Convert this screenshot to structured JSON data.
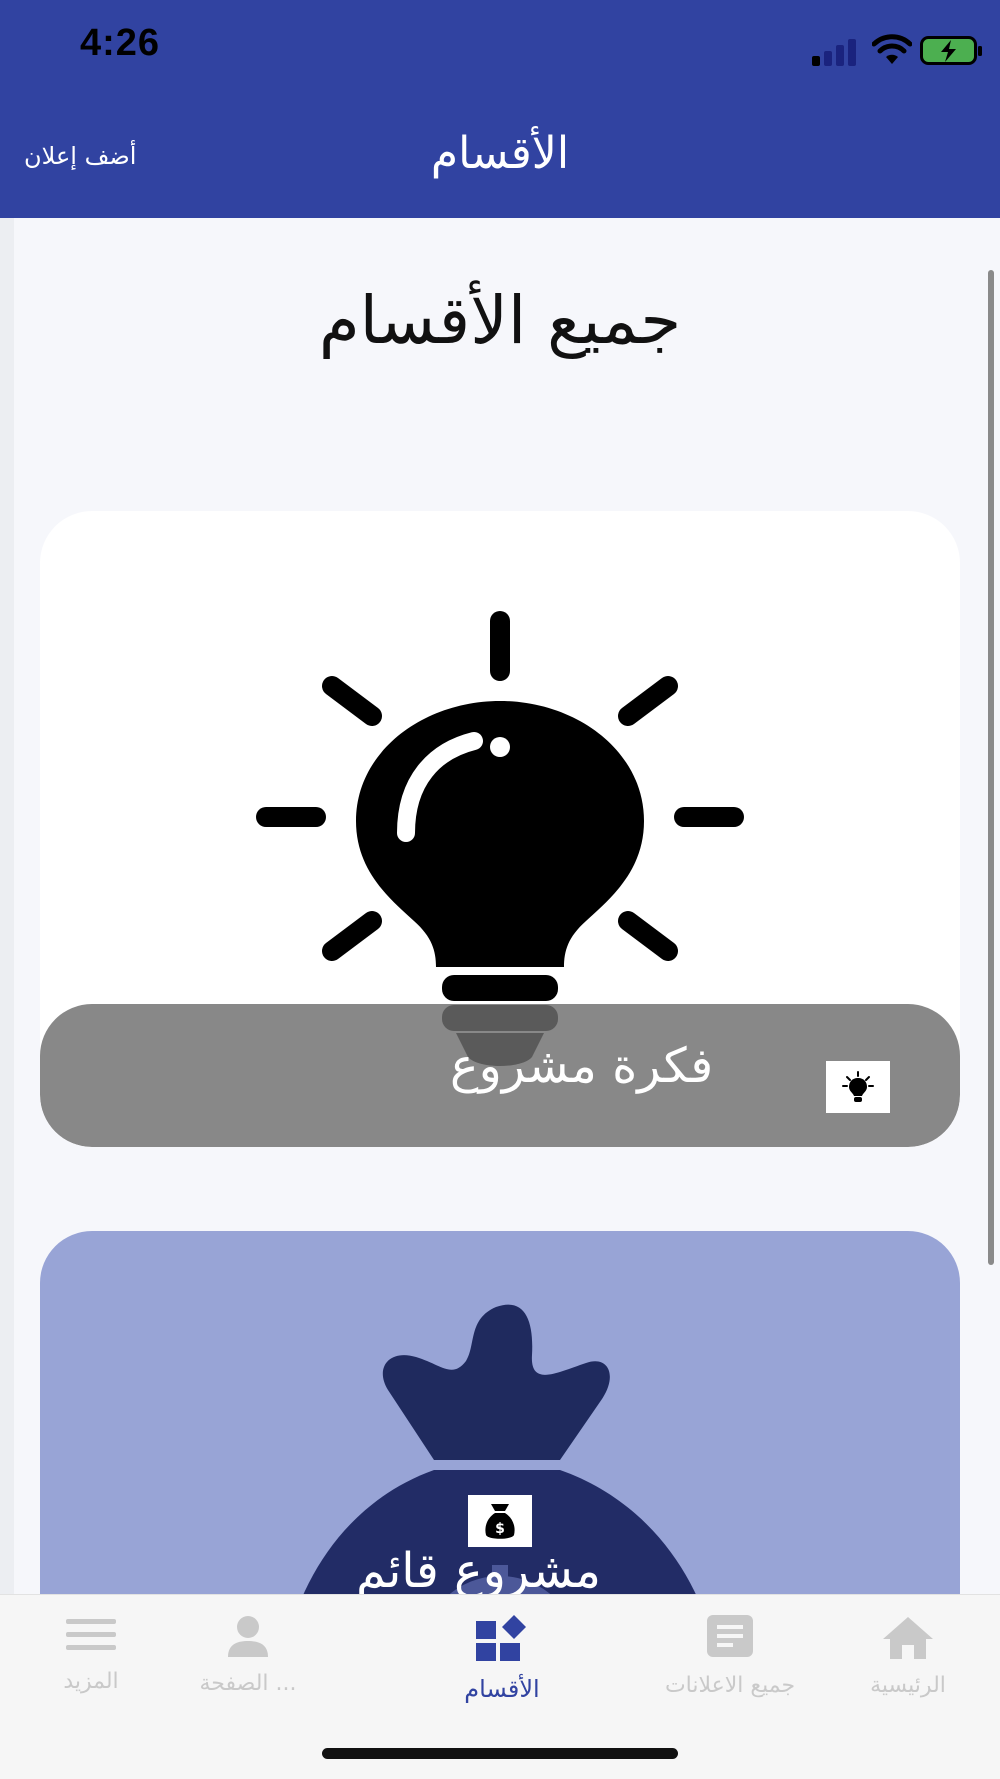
{
  "status_bar": {
    "time": "4:26"
  },
  "nav": {
    "title": "الأقسام",
    "add_button_label": "أضف إعلان"
  },
  "page": {
    "heading": "جميع الأقسام"
  },
  "categories": [
    {
      "label": "فكرة مشروع",
      "icon": "lightbulb-icon"
    },
    {
      "label": "مشروع قائم",
      "icon": "money-bag-icon"
    }
  ],
  "tabbar": {
    "items": [
      {
        "label": "المزيد",
        "icon": "menu-icon",
        "active": false
      },
      {
        "label": "الصفحة ...",
        "icon": "person-icon",
        "active": false
      },
      {
        "label": "الأقسام",
        "icon": "categories-icon",
        "active": true
      },
      {
        "label": "جميع الاعلانات",
        "icon": "document-icon",
        "active": false
      },
      {
        "label": "الرئيسية",
        "icon": "home-icon",
        "active": false
      }
    ]
  },
  "colors": {
    "brand": "#3143a1",
    "card_2_bg": "#98a4d6",
    "inactive_tab": "#c9c9c9"
  }
}
